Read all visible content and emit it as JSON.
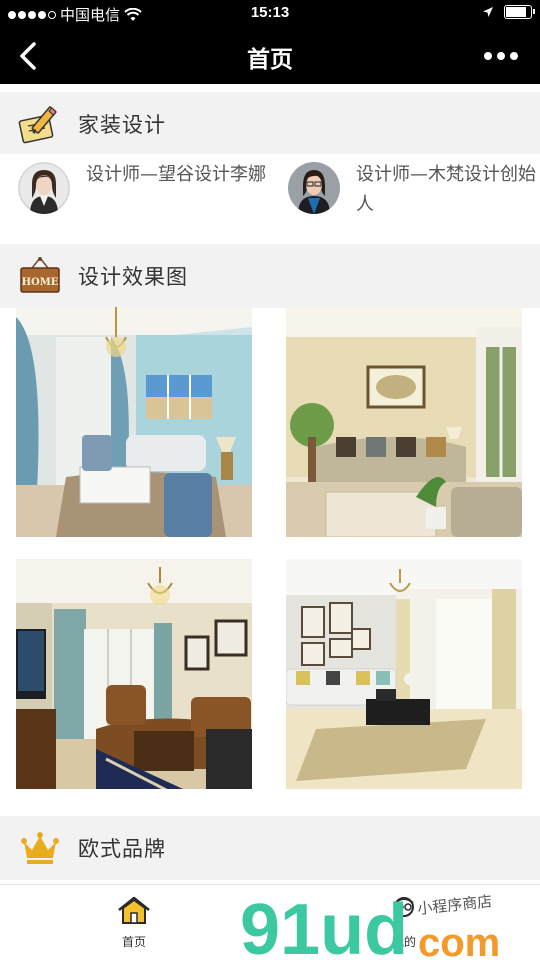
{
  "status_bar": {
    "carrier": "中国电信",
    "time": "15:13"
  },
  "nav": {
    "title": "首页"
  },
  "sections": {
    "home_design": {
      "label": "家装设计",
      "icon": "pencil-paper-icon"
    },
    "renderings": {
      "label": "设计效果图",
      "icon": "home-sign-icon"
    },
    "european_brand": {
      "label": "欧式品牌",
      "icon": "crown-icon"
    }
  },
  "designers": [
    {
      "name": "设计师—望谷设计李娜"
    },
    {
      "name": "设计师—木梵设计创始人"
    }
  ],
  "tabs": [
    {
      "label": "首页",
      "icon": "home-icon"
    },
    {
      "label": "我的",
      "icon": "profile-icon"
    }
  ],
  "watermark": {
    "brand": "91ud",
    "suffix": "com",
    "tagline": "小程序商店"
  },
  "colors": {
    "bar_bg": "#000000",
    "section_bg": "#f2f2f2",
    "accent_gold": "#e0a81c"
  }
}
